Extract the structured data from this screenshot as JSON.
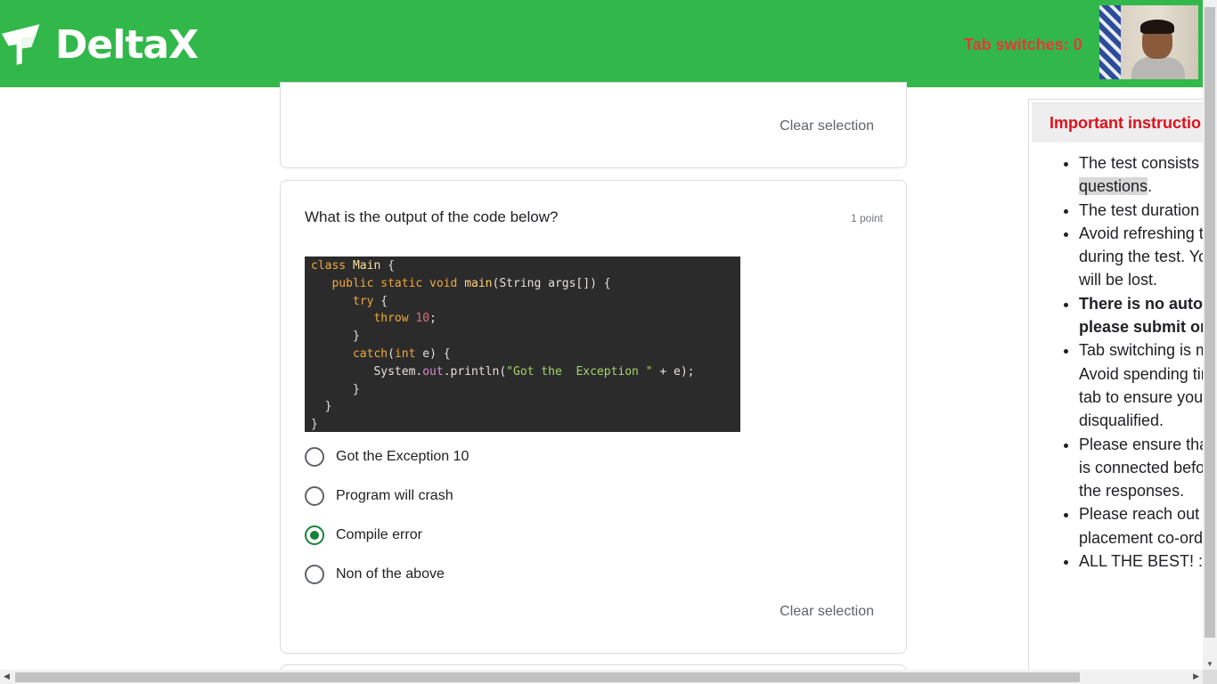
{
  "header": {
    "brand": "DeltaX",
    "tab_switches": "Tab switches: 0",
    "accent": "#32b84a",
    "tab_switches_color": "#e53935"
  },
  "previous_card": {
    "clear_label": "Clear selection"
  },
  "question_card": {
    "question": "What is the output of the code below?",
    "points": "1 point",
    "code_lines": [
      "class Main {",
      "   public static void main(String args[]) {",
      "      try {",
      "         throw 10;",
      "      }",
      "      catch(int e) {",
      "         System.out.println(\"Got the  Exception \" + e);",
      "      }",
      "  }",
      "}"
    ],
    "options": [
      {
        "label": "Got the Exception 10",
        "selected": false
      },
      {
        "label": "Program will crash",
        "selected": false
      },
      {
        "label": "Compile error",
        "selected": true
      },
      {
        "label": "Non of the above",
        "selected": false
      }
    ],
    "clear_label": "Clear selection"
  },
  "instructions_panel": {
    "title": "Important instructio",
    "items": [
      {
        "text_1": "The test consists ",
        "highlight": "questions",
        "text_2": "."
      },
      {
        "text": "The test duration "
      },
      {
        "text": "Avoid refreshing t during the test. Yo will be lost."
      },
      {
        "bold": "There is no auto- please submit or"
      },
      {
        "text": "Tab switching is m Avoid spending tir tab to ensure you disqualified."
      },
      {
        "text": "Please ensure tha is connected befo the responses."
      },
      {
        "text": "Please reach out placement co-ordi"
      },
      {
        "text": "ALL THE BEST! :"
      }
    ]
  }
}
